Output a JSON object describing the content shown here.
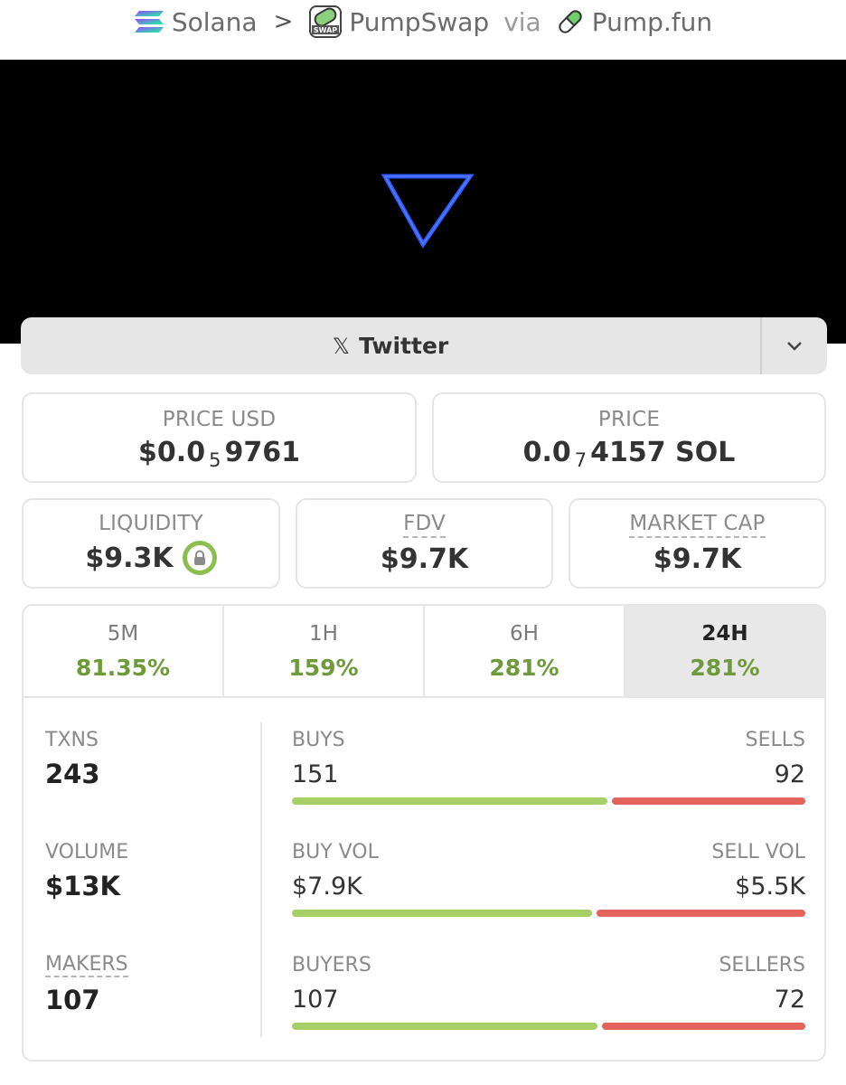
{
  "breadcrumb": {
    "chain": "Solana",
    "separator": ">",
    "dex": "PumpSwap",
    "via": "via",
    "source": "Pump.fun"
  },
  "banner": {
    "logo": "blue-inverted-triangle-icon"
  },
  "social": {
    "icon": "x-icon",
    "label": "Twitter",
    "toggle_icon": "chevron-down-icon"
  },
  "price_usd": {
    "label": "PRICE USD",
    "prefix": "$0.0",
    "zeros": "5",
    "digits": "9761"
  },
  "price_native": {
    "label": "PRICE",
    "prefix": "0.0",
    "zeros": "7",
    "digits": "4157 SOL"
  },
  "liquidity": {
    "label": "LIQUIDITY",
    "value": "$9.3K",
    "icon": "lock-icon"
  },
  "fdv": {
    "label": "FDV",
    "value": "$9.7K"
  },
  "market_cap": {
    "label": "MARKET CAP",
    "value": "$9.7K"
  },
  "timeframes": [
    {
      "label": "5M",
      "change": "81.35%"
    },
    {
      "label": "1H",
      "change": "159%"
    },
    {
      "label": "6H",
      "change": "281%"
    },
    {
      "label": "24H",
      "change": "281%",
      "active": true
    }
  ],
  "totals": {
    "txns": {
      "label": "TXNS",
      "value": "243"
    },
    "volume": {
      "label": "VOLUME",
      "value": "$13K"
    },
    "makers": {
      "label": "MAKERS",
      "value": "107"
    }
  },
  "splits": {
    "txns": {
      "left_label": "BUYS",
      "right_label": "SELLS",
      "left_value": "151",
      "right_value": "92",
      "buy_fraction": 0.62
    },
    "volume": {
      "left_label": "BUY VOL",
      "right_label": "SELL VOL",
      "left_value": "$7.9K",
      "right_value": "$5.5K",
      "buy_fraction": 0.59
    },
    "makers": {
      "left_label": "BUYERS",
      "right_label": "SELLERS",
      "left_value": "107",
      "right_value": "72",
      "buy_fraction": 0.6
    }
  },
  "colors": {
    "positive": "#6e9a3a",
    "buy_bar": "#a6cf67",
    "sell_bar": "#e2645d",
    "accent_blue": "#2f5cff"
  }
}
